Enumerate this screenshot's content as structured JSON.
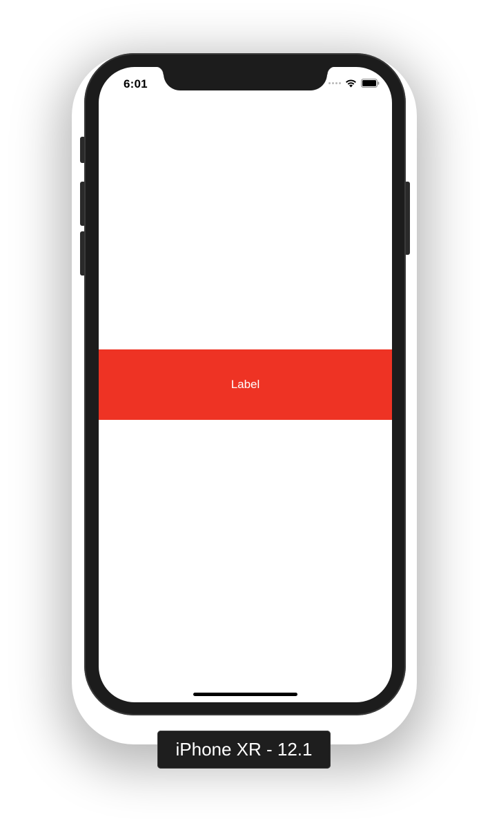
{
  "status_bar": {
    "time": "6:01",
    "signal_icon": "cellular-signal-icon",
    "wifi_icon": "wifi-icon",
    "battery_icon": "battery-icon"
  },
  "main": {
    "label_text": "Label",
    "label_background": "#ee3324"
  },
  "simulator": {
    "device_caption": "iPhone XR - 12.1"
  }
}
